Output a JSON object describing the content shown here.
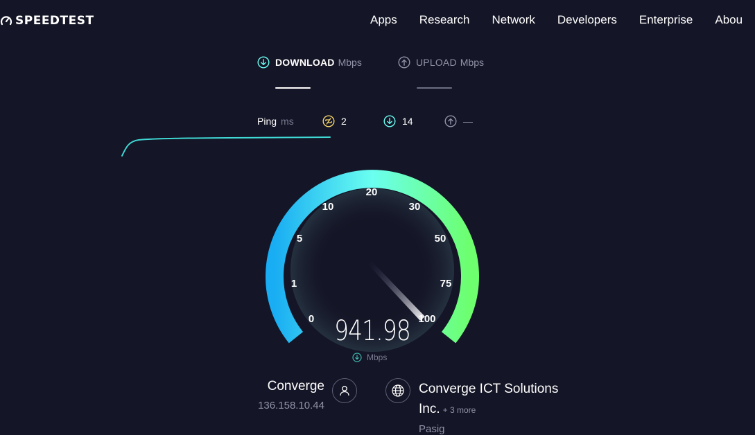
{
  "header": {
    "logo_text": "SPEEDTEST",
    "nav": [
      "Apps",
      "Research",
      "Network",
      "Developers",
      "Enterprise",
      "Abou"
    ]
  },
  "tabs": {
    "download": {
      "label": "DOWNLOAD",
      "unit": "Mbps",
      "icon": "arrow-down-circle-icon"
    },
    "upload": {
      "label": "UPLOAD",
      "unit": "Mbps",
      "icon": "arrow-up-circle-icon"
    }
  },
  "ping": {
    "label": "Ping",
    "unit": "ms",
    "idle": "2",
    "download": "14",
    "upload": "—"
  },
  "gauge": {
    "ticks": [
      "0",
      "1",
      "5",
      "10",
      "20",
      "30",
      "50",
      "75",
      "100"
    ],
    "speed": "941.98",
    "unit": "Mbps",
    "colors": {
      "start": "#1eb4f5",
      "mid": "#6afff0",
      "end": "#6dff6d"
    }
  },
  "isp": {
    "name": "Converge",
    "ip": "136.158.10.44"
  },
  "server": {
    "name": "Converge ICT Solutions Inc.",
    "more": "+ 3 more",
    "location": "Pasig"
  }
}
